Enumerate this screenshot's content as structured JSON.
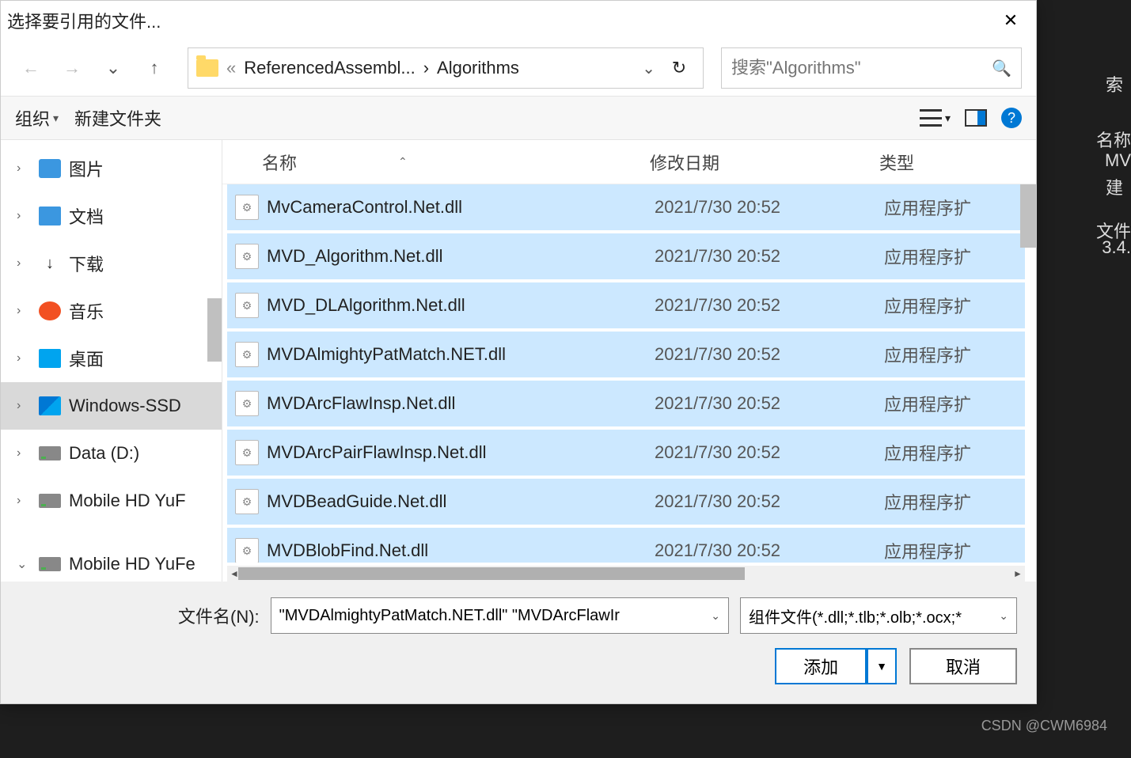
{
  "dialog": {
    "title": "选择要引用的文件...",
    "breadcrumb": {
      "sep": "«",
      "part1": "ReferencedAssembl...",
      "part2": "Algorithms"
    },
    "search_placeholder": "搜索\"Algorithms\"",
    "toolbar": {
      "organize": "组织",
      "newfolder": "新建文件夹"
    },
    "columns": {
      "name": "名称",
      "date": "修改日期",
      "type": "类型"
    },
    "sidebar": [
      {
        "label": "图片",
        "chev": "›",
        "ico": "ico-pic"
      },
      {
        "label": "文档",
        "chev": "›",
        "ico": "ico-doc"
      },
      {
        "label": "下载",
        "chev": "›",
        "ico": "ico-dl"
      },
      {
        "label": "音乐",
        "chev": "›",
        "ico": "ico-music"
      },
      {
        "label": "桌面",
        "chev": "›",
        "ico": "ico-desk"
      },
      {
        "label": "Windows-SSD",
        "chev": "›",
        "ico": "ico-win",
        "sel": true
      },
      {
        "label": "Data (D:)",
        "chev": "›",
        "ico": "ico-drive"
      },
      {
        "label": "Mobile HD YuF",
        "chev": "›",
        "ico": "ico-drive"
      },
      {
        "label": "Mobile HD YuFe",
        "chev": "⌄",
        "ico": "ico-drive"
      }
    ],
    "files": [
      {
        "name": "MvCameraControl.Net.dll",
        "date": "2021/7/30 20:52",
        "type": "应用程序扩"
      },
      {
        "name": "MVD_Algorithm.Net.dll",
        "date": "2021/7/30 20:52",
        "type": "应用程序扩"
      },
      {
        "name": "MVD_DLAlgorithm.Net.dll",
        "date": "2021/7/30 20:52",
        "type": "应用程序扩"
      },
      {
        "name": "MVDAlmightyPatMatch.NET.dll",
        "date": "2021/7/30 20:52",
        "type": "应用程序扩"
      },
      {
        "name": "MVDArcFlawInsp.Net.dll",
        "date": "2021/7/30 20:52",
        "type": "应用程序扩"
      },
      {
        "name": "MVDArcPairFlawInsp.Net.dll",
        "date": "2021/7/30 20:52",
        "type": "应用程序扩"
      },
      {
        "name": "MVDBeadGuide.Net.dll",
        "date": "2021/7/30 20:52",
        "type": "应用程序扩"
      },
      {
        "name": "MVDBlobFind.Net.dll",
        "date": "2021/7/30 20:52",
        "type": "应用程序扩"
      }
    ],
    "filename_label": "文件名(N):",
    "filename_value": "\"MVDAlmightyPatMatch.NET.dll\" \"MVDArcFlawIr",
    "filter": "组件文件(*.dll;*.tlb;*.olb;*.ocx;*",
    "add_btn": "添加",
    "cancel_btn": "取消"
  },
  "bg": {
    "t1": "索",
    "t2": "名称",
    "t3": "MV",
    "t4": "建",
    "t5": "文件",
    "t6": "3.4."
  },
  "watermark": "CSDN @CWM6984"
}
